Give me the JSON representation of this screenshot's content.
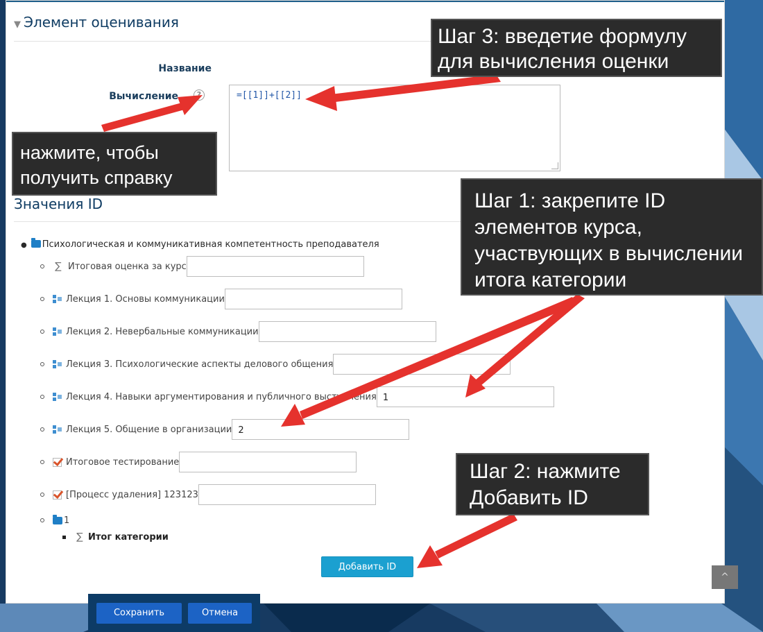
{
  "section": {
    "legend": "Элемент оценивания",
    "name_label": "Название",
    "calc_label": "Вычисление",
    "help_glyph": "?",
    "calc_value": "=[[1]]+[[2]]"
  },
  "id_values": {
    "title": "Значения ID",
    "root_label": "Психологическая и коммуникативная компетентность преподавателя",
    "items": [
      {
        "icon": "sigma-icon",
        "label": "Итоговая оценка за курс",
        "value": ""
      },
      {
        "icon": "lecture-icon",
        "label": "Лекция 1. Основы коммуникации",
        "value": ""
      },
      {
        "icon": "lecture-icon",
        "label": "Лекция 2. Невербальные коммуникации",
        "value": ""
      },
      {
        "icon": "lecture-icon",
        "label": "Лекция 3. Психологические аспекты делового общения",
        "value": ""
      },
      {
        "icon": "lecture-icon",
        "label": "Лекция 4. Навыки аргументирования и публичного выступления",
        "value": "1"
      },
      {
        "icon": "lecture-icon",
        "label": "Лекция 5. Общение в организации",
        "value": "2"
      },
      {
        "icon": "quiz-icon",
        "label": "Итоговое тестирование",
        "value": ""
      },
      {
        "icon": "quiz-icon",
        "label": "[Процесс удаления] 123123",
        "value": ""
      }
    ],
    "subcategory_label": "1",
    "category_total_label": "Итог категории"
  },
  "buttons": {
    "add_id": "Добавить ID",
    "save": "Сохранить",
    "cancel": "Отмена",
    "scroll_top": "^"
  },
  "callouts": {
    "step3": [
      "Шаг 3: введетие формулу",
      "для вычисления оценки"
    ],
    "help": [
      "нажмите, чтобы",
      "получить справку"
    ],
    "step1": [
      "Шаг 1: закрепите ID",
      "элементов курса,",
      "участвующих в вычислении",
      "итога категории"
    ],
    "step2": [
      "Шаг 2: нажмите",
      "Добавить ID"
    ]
  },
  "colors": {
    "accent": "#1ba0d0",
    "primary_button": "#1c63c5",
    "heading": "#0f3c63",
    "arrow": "#e5322d",
    "callout_bg": "#2b2b2b"
  }
}
